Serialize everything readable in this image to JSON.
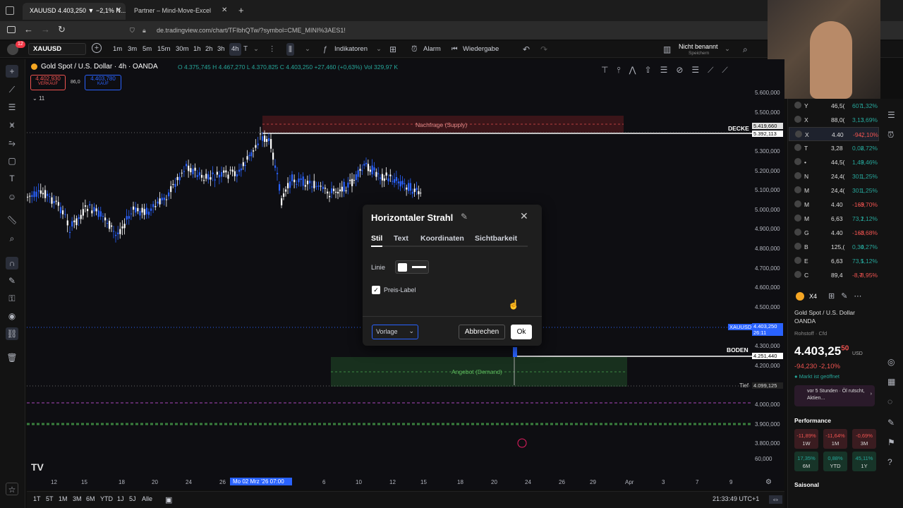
{
  "browser": {
    "tabs": [
      "XAUUSD 4.403,250 ▼ −2,1% N...",
      "Partner – Mind-Move-Excel"
    ],
    "url": "de.tradingview.com/chart/TFIbhQTw/?symbol=CME_MINI%3AES1!"
  },
  "toolbar": {
    "symbol": "XAUUSD",
    "timeframes": [
      "1m",
      "3m",
      "5m",
      "15m",
      "30m",
      "1h",
      "2h",
      "3h",
      "4h"
    ],
    "active_timeframe": "4h",
    "indicators_label": "Indikatoren",
    "alert_label": "Alarm",
    "replay_label": "Wiedergabe",
    "layout_name": "Nicht benannt",
    "layout_status": "Speichern",
    "notification_count": "12"
  },
  "legend": {
    "title": "Gold Spot / U.S. Dollar · 4h · OANDA",
    "ohlc": "O 4.375,745  H 4.467,270  L 4.370,825  C 4.403,250 +27,460 (+0,63%)  Vol 329,97 K",
    "sell_price": "4.402,930",
    "sell_label": "VERKAUF",
    "spread": "86,0",
    "buy_price": "4.403,780",
    "buy_label": "KAUF",
    "indicator_count": "11"
  },
  "zones": {
    "supply_label": "Nachfrage (Supply)",
    "demand_label": "Angebot (Demand)",
    "ceiling_label": "DECKE",
    "floor_label": "BODEN",
    "low_label": "Tief"
  },
  "price_axis": [
    "5.600,000",
    "5.500,000",
    "5.300,000",
    "5.200,000",
    "5.100,000",
    "5.000,000",
    "4.900,000",
    "4.800,000",
    "4.700,000",
    "4.600,000",
    "4.500,000",
    "4.300,000",
    "4.200,000",
    "4.000,000",
    "3.900,000",
    "3.800,000",
    "60,000"
  ],
  "price_tags": {
    "ceiling_top": "5.419,660",
    "ceiling": "5.392,113",
    "current_symbol": "XAUUSD",
    "current": "4.403,250",
    "countdown": "26:11",
    "floor": "4.251,440",
    "low": "4.099,125"
  },
  "time_axis": [
    "12",
    "15",
    "18",
    "20",
    "24",
    "26",
    "6",
    "10",
    "12",
    "15",
    "18",
    "20",
    "24",
    "26",
    "29",
    "Apr",
    "3",
    "7",
    "9"
  ],
  "time_cursor": "Mo 02 Mrz '26  07:00",
  "bottom_bar": {
    "ranges": [
      "1T",
      "5T",
      "1M",
      "3M",
      "6M",
      "YTD",
      "1J",
      "5J",
      "Alle"
    ],
    "clock": "21:33:49 UTC+1"
  },
  "dialog": {
    "title": "Horizontaler Strahl",
    "tabs": [
      "Stil",
      "Text",
      "Koordinaten",
      "Sichtbarkeit"
    ],
    "active_tab": "Stil",
    "line_label": "Linie",
    "price_label_checkbox": "Preis-Label",
    "template_label": "Vorlage",
    "cancel_label": "Abbrechen",
    "ok_label": "Ok"
  },
  "watchlist": [
    {
      "sym": "Y",
      "val": "46,5(",
      "chg": "607",
      "pct": "1,32%",
      "color": "#26a69a"
    },
    {
      "sym": "X",
      "val": "88,0(",
      "chg": "3,13",
      "pct": "3,69%",
      "color": "#26a69a"
    },
    {
      "sym": "X",
      "val": "4.40",
      "chg": "-94,",
      "pct": "-2,10%",
      "color": "#ef5350"
    },
    {
      "sym": "T",
      "val": "3,28",
      "chg": "0,08",
      "pct": "2,72%",
      "color": "#26a69a"
    },
    {
      "sym": "•",
      "val": "44,5(",
      "chg": "1,49",
      "pct": "3,46%",
      "color": "#26a69a"
    },
    {
      "sym": "N",
      "val": "24,4(",
      "chg": "301,",
      "pct": "1,25%",
      "color": "#26a69a"
    },
    {
      "sym": "M",
      "val": "24,4(",
      "chg": "301,",
      "pct": "1,25%",
      "color": "#26a69a"
    },
    {
      "sym": "M",
      "val": "4.40",
      "chg": "-169",
      "pct": "-3,70%",
      "color": "#ef5350"
    },
    {
      "sym": "M",
      "val": "6,63",
      "chg": "73,2",
      "pct": "1,12%",
      "color": "#26a69a"
    },
    {
      "sym": "G",
      "val": "4.40",
      "chg": "-168",
      "pct": "-3,68%",
      "color": "#ef5350"
    },
    {
      "sym": "B",
      "val": "125,(",
      "chg": "0,34",
      "pct": "0,27%",
      "color": "#26a69a"
    },
    {
      "sym": "E",
      "val": "6,63",
      "chg": "73,5",
      "pct": "1,12%",
      "color": "#26a69a"
    },
    {
      "sym": "C",
      "val": "89,4",
      "chg": "-8,7",
      "pct": "-8,95%",
      "color": "#ef5350"
    }
  ],
  "details": {
    "symbol_short": "X4",
    "name": "Gold Spot / U.S. Dollar",
    "exchange": "OANDA",
    "type": "Rohstoff · Cfd",
    "price": "4.403,25",
    "price_sup": "50",
    "currency": "USD",
    "change": "-94,230  -2,10%",
    "market_status": "Markt ist geöffnet",
    "news": "vor 5 Stunden · Öl rutscht, Aktien...",
    "performance_label": "Performance",
    "seasonal_label": "Saisonal",
    "performance": [
      {
        "val": "-11,89%",
        "label": "1W",
        "color": "#ef5350"
      },
      {
        "val": "-11,64%",
        "label": "1M",
        "color": "#ef5350"
      },
      {
        "val": "-0,69%",
        "label": "3M",
        "color": "#ef5350"
      },
      {
        "val": "17,35%",
        "label": "6M",
        "color": "#26a69a"
      },
      {
        "val": "0,88%",
        "label": "YTD",
        "color": "#26a69a"
      },
      {
        "val": "45,11%",
        "label": "1Y",
        "color": "#26a69a"
      }
    ]
  },
  "colors": {
    "up": "#2962ff",
    "down": "#ffffff",
    "supply_zone": "#5a1a1e",
    "demand_zone": "#1c3a22",
    "accent": "#2962ff"
  }
}
